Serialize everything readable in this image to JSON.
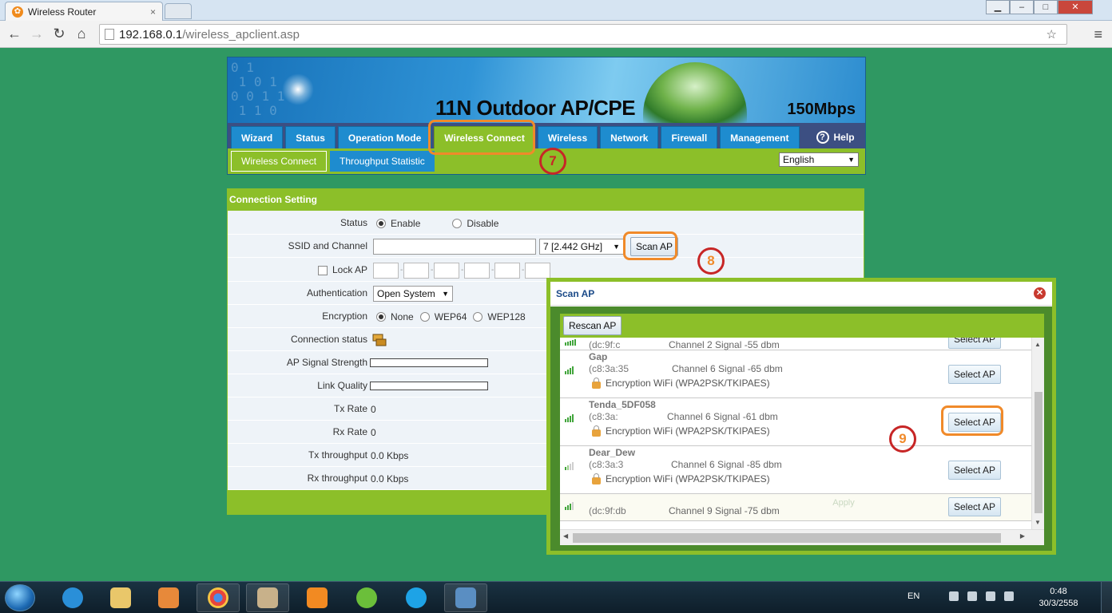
{
  "browser": {
    "tab_title": "Wireless Router",
    "tab_close": "×",
    "url_host": "192.168.0.1",
    "url_path": "/wireless_apclient.asp",
    "nav_back": "←",
    "nav_forward": "→",
    "nav_reload": "↻",
    "nav_home": "⌂",
    "star": "☆",
    "menu": "≡",
    "window_minimize": "▁",
    "window_restore": "–",
    "window_maximize": "□",
    "window_close": "✕"
  },
  "router": {
    "banner_title": "11N Outdoor AP/CPE",
    "banner_speed": "150Mbps",
    "main_tabs": [
      "Wizard",
      "Status",
      "Operation Mode",
      "Wireless Connect",
      "Wireless",
      "Network",
      "Firewall",
      "Management"
    ],
    "help_label": "Help",
    "sub_tabs": [
      "Wireless Connect",
      "Throughput Statistic"
    ],
    "language": "English"
  },
  "connection": {
    "header": "Connection Setting",
    "status_label": "Status",
    "status_enable": "Enable",
    "status_disable": "Disable",
    "ssid_label": "SSID and Channel",
    "ssid_value": "",
    "channel_value": "7 [2.442 GHz]",
    "scan_button": "Scan AP",
    "lock_ap_label": "Lock AP",
    "auth_label": "Authentication",
    "auth_value": "Open System",
    "enc_label": "Encryption",
    "enc_none": "None",
    "enc_wep64": "WEP64",
    "enc_wep128": "WEP128",
    "conn_status_label": "Connection status",
    "signal_label": "AP Signal Strength",
    "signal_level": 0,
    "link_label": "Link Quality",
    "link_level": 0,
    "tx_rate_label": "Tx Rate",
    "tx_rate_value": "0",
    "rx_rate_label": "Rx Rate",
    "rx_rate_value": "0",
    "tx_tp_label": "Tx throughput",
    "tx_tp_value": "0.0 Kbps",
    "rx_tp_label": "Rx throughput",
    "rx_tp_value": "0.0 Kbps",
    "ghost_apply": "Apply"
  },
  "scan_dialog": {
    "title": "Scan AP",
    "rescan_button": "Rescan AP",
    "select_label": "Select AP",
    "ap_list": [
      {
        "name": "",
        "mac": "(dc:9f:c",
        "channel_signal": "Channel 2 Signal -55 dbm",
        "encryption": ""
      },
      {
        "name": "Gap",
        "mac": "(c8:3a:35",
        "channel_signal": "Channel 6 Signal -65 dbm",
        "encryption": "Encryption WiFi (WPA2PSK/TKIPAES)"
      },
      {
        "name": "Tenda_5DF058",
        "mac": "(c8:3a:",
        "channel_signal": "Channel 6 Signal -61 dbm",
        "encryption": "Encryption WiFi (WPA2PSK/TKIPAES)"
      },
      {
        "name": "Dear_Dew",
        "mac": "(c8:3a:3",
        "channel_signal": "Channel 6 Signal -85 dbm",
        "encryption": "Encryption WiFi (WPA2PSK/TKIPAES)"
      },
      {
        "name": "",
        "mac": "(dc:9f:db",
        "channel_signal": "Channel 9 Signal -75 dbm",
        "encryption": ""
      }
    ]
  },
  "annotations": [
    "7",
    "8",
    "9"
  ],
  "taskbar": {
    "lang": "EN",
    "time": "0:48",
    "date": "30/3/2558"
  },
  "colors": {
    "page_bg": "#2f9862",
    "nav_blue": "#1e8ccf",
    "accent_green": "#8cbf29",
    "highlight_orange": "#f08a2a",
    "annotation_red": "#c72626"
  },
  "icons": [
    "back-arrow-icon",
    "forward-arrow-icon",
    "reload-icon",
    "home-icon",
    "star-icon",
    "menu-icon",
    "help-icon",
    "network-computers-icon",
    "lock-icon",
    "signal-icon",
    "close-icon"
  ]
}
